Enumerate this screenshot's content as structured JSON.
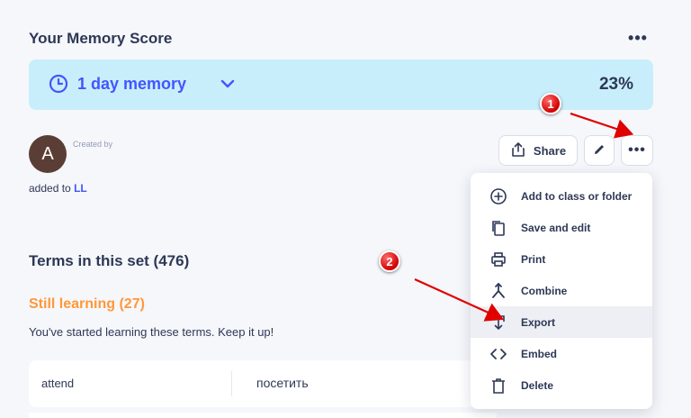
{
  "memory": {
    "heading": "Your Memory Score",
    "label": "1 day memory",
    "percent": "23%"
  },
  "owner": {
    "avatar_letter": "A",
    "created_by_label": "Created by",
    "added_prefix": "added to",
    "folder_link": "LL"
  },
  "actions": {
    "share_label": "Share"
  },
  "terms": {
    "heading": "Terms in this set (476)",
    "still_learning": "Still learning (27)",
    "still_learning_sub": "You've started learning these terms. Keep it up!",
    "rows": [
      {
        "term": "attend",
        "definition": "посетить"
      }
    ]
  },
  "menu": {
    "items": [
      {
        "label": "Add to class or folder",
        "icon": "plus-circle-icon"
      },
      {
        "label": "Save and edit",
        "icon": "copy-icon"
      },
      {
        "label": "Print",
        "icon": "printer-icon"
      },
      {
        "label": "Combine",
        "icon": "merge-icon"
      },
      {
        "label": "Export",
        "icon": "export-icon"
      },
      {
        "label": "Embed",
        "icon": "code-icon"
      },
      {
        "label": "Delete",
        "icon": "trash-icon"
      }
    ],
    "active_item": "Export"
  },
  "annotations": {
    "badge1": "1",
    "badge2": "2"
  },
  "colors": {
    "accent": "#4255ff",
    "memory_bg": "#c9eefb",
    "still_learning": "#ff983a",
    "annotation_red": "#e00000"
  }
}
